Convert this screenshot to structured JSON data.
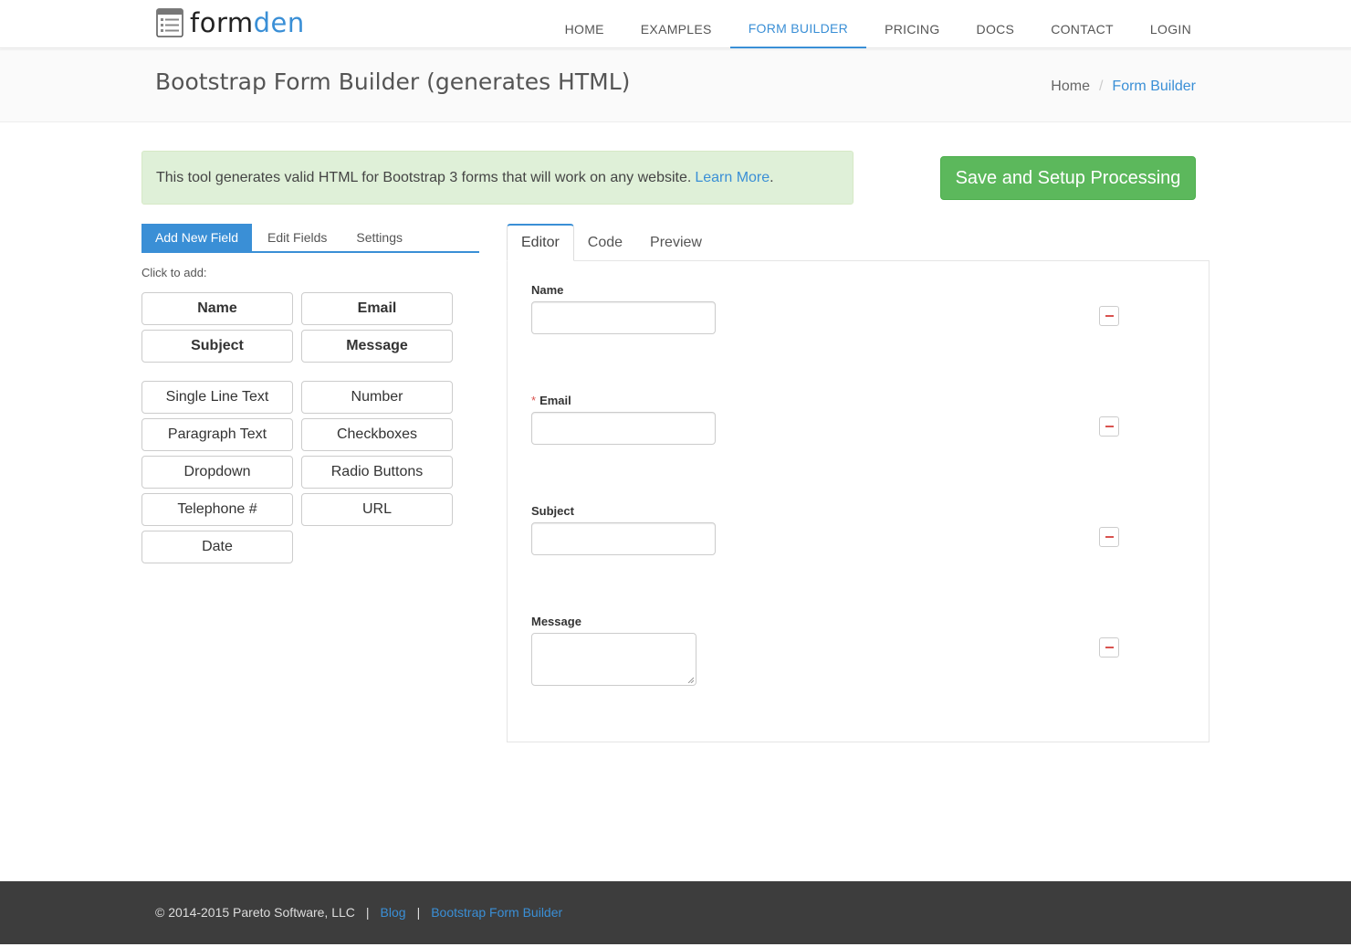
{
  "brand": {
    "part1": "form",
    "part2": "den",
    "icon": "document-list-icon"
  },
  "nav": {
    "items": [
      {
        "label": "HOME"
      },
      {
        "label": "EXAMPLES"
      },
      {
        "label": "FORM BUILDER"
      },
      {
        "label": "PRICING"
      },
      {
        "label": "DOCS"
      },
      {
        "label": "CONTACT"
      },
      {
        "label": "LOGIN"
      }
    ],
    "active": "FORM BUILDER"
  },
  "header": {
    "title": "Bootstrap Form Builder (generates HTML)",
    "breadcrumb": {
      "home": "Home",
      "separator": "/",
      "current": "Form Builder"
    }
  },
  "alert": {
    "text": "This tool generates valid HTML for Bootstrap 3 forms that will work on any website.",
    "link": "Learn More",
    "after": "."
  },
  "save_button": "Save and Setup Processing",
  "left_panel": {
    "tabs": [
      {
        "label": "Add New Field"
      },
      {
        "label": "Edit Fields"
      },
      {
        "label": "Settings"
      }
    ],
    "click_to_add": "Click to add:",
    "preset_fields": [
      "Name",
      "Email",
      "Subject",
      "Message"
    ],
    "field_types": [
      "Single Line Text",
      "Number",
      "Paragraph Text",
      "Checkboxes",
      "Dropdown",
      "Radio Buttons",
      "Telephone #",
      "URL",
      "Date"
    ]
  },
  "right_panel": {
    "tabs": [
      {
        "label": "Editor"
      },
      {
        "label": "Code"
      },
      {
        "label": "Preview"
      }
    ],
    "fields": [
      {
        "label": "Name",
        "required": false,
        "type": "text"
      },
      {
        "label": "Email",
        "required": true,
        "type": "text"
      },
      {
        "label": "Subject",
        "required": false,
        "type": "text"
      },
      {
        "label": "Message",
        "required": false,
        "type": "textarea"
      }
    ],
    "required_marker": "*"
  },
  "footer": {
    "copyright": "© 2014-2015 Pareto Software, LLC",
    "sep": "|",
    "links": [
      "Blog",
      "Bootstrap Form Builder"
    ]
  },
  "colors": {
    "accent": "#3a8fd6",
    "success": "#5cb85c",
    "alert_bg": "#dff0d8",
    "danger": "#d9534f",
    "footer_bg": "#3d3d3d"
  }
}
